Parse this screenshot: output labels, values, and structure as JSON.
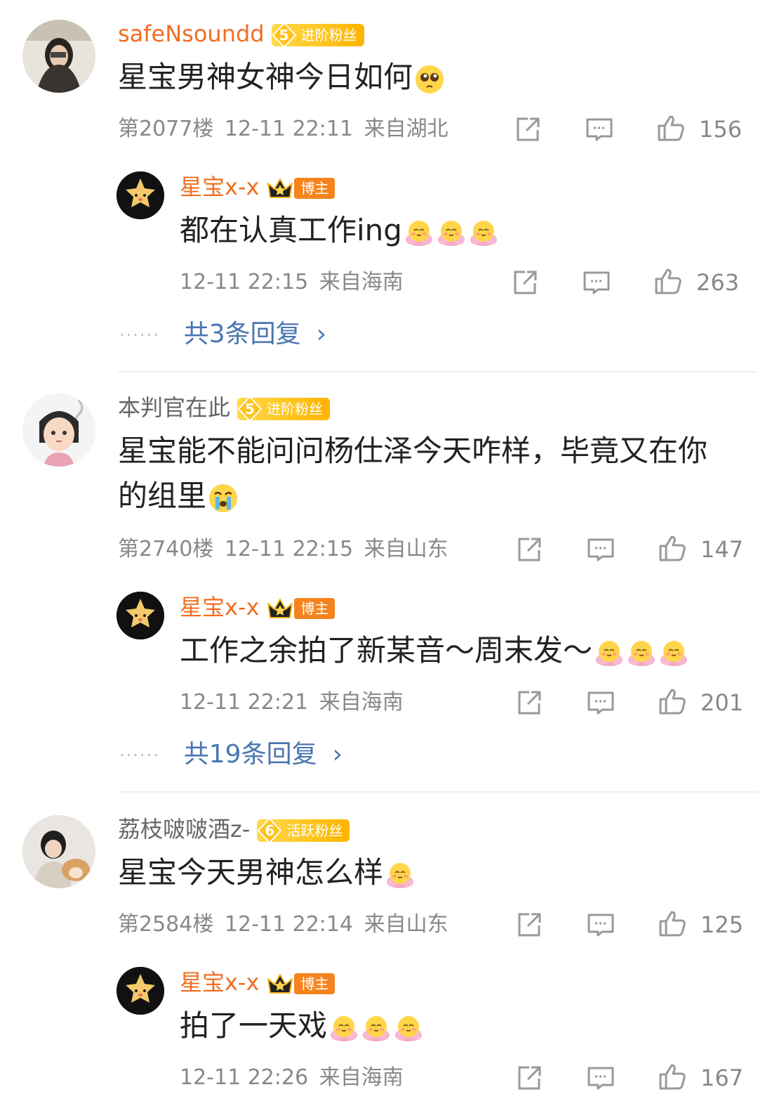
{
  "comments": [
    {
      "user": "safeNsoundd",
      "badge": {
        "level": "5",
        "label": "进阶粉丝"
      },
      "text": "星宝男神女神今日如何",
      "floor": "第2077楼",
      "time": "12-11 22:11",
      "location": "来自湖北",
      "likes": "156",
      "reply": {
        "user": "星宝x-x",
        "badge": "博主",
        "text": "都在认真工作ing",
        "time": "12-11 22:15",
        "location": "来自海南",
        "likes": "263"
      },
      "more_replies": "共3条回复"
    },
    {
      "user": "本判官在此",
      "badge": {
        "level": "5",
        "label": "进阶粉丝"
      },
      "text": "星宝能不能问问杨仕泽今天咋样，毕竟又在你的组里",
      "floor": "第2740楼",
      "time": "12-11 22:15",
      "location": "来自山东",
      "likes": "147",
      "reply": {
        "user": "星宝x-x",
        "badge": "博主",
        "text": "工作之余拍了新某音～周末发～",
        "time": "12-11 22:21",
        "location": "来自海南",
        "likes": "201"
      },
      "more_replies": "共19条回复"
    },
    {
      "user": "荔枝啵啵酒z-",
      "badge": {
        "level": "6",
        "label": "活跃粉丝"
      },
      "text": "星宝今天男神怎么样",
      "floor": "第2584楼",
      "time": "12-11 22:14",
      "location": "来自山东",
      "likes": "125",
      "reply": {
        "user": "星宝x-x",
        "badge": "博主",
        "text": "拍了一天戏",
        "time": "12-11 22:26",
        "location": "来自海南",
        "likes": "167"
      }
    }
  ],
  "more_arrow": "›",
  "colors": {
    "link": "#4a76b0",
    "orange_name": "#f26d21",
    "meta": "#888888"
  }
}
